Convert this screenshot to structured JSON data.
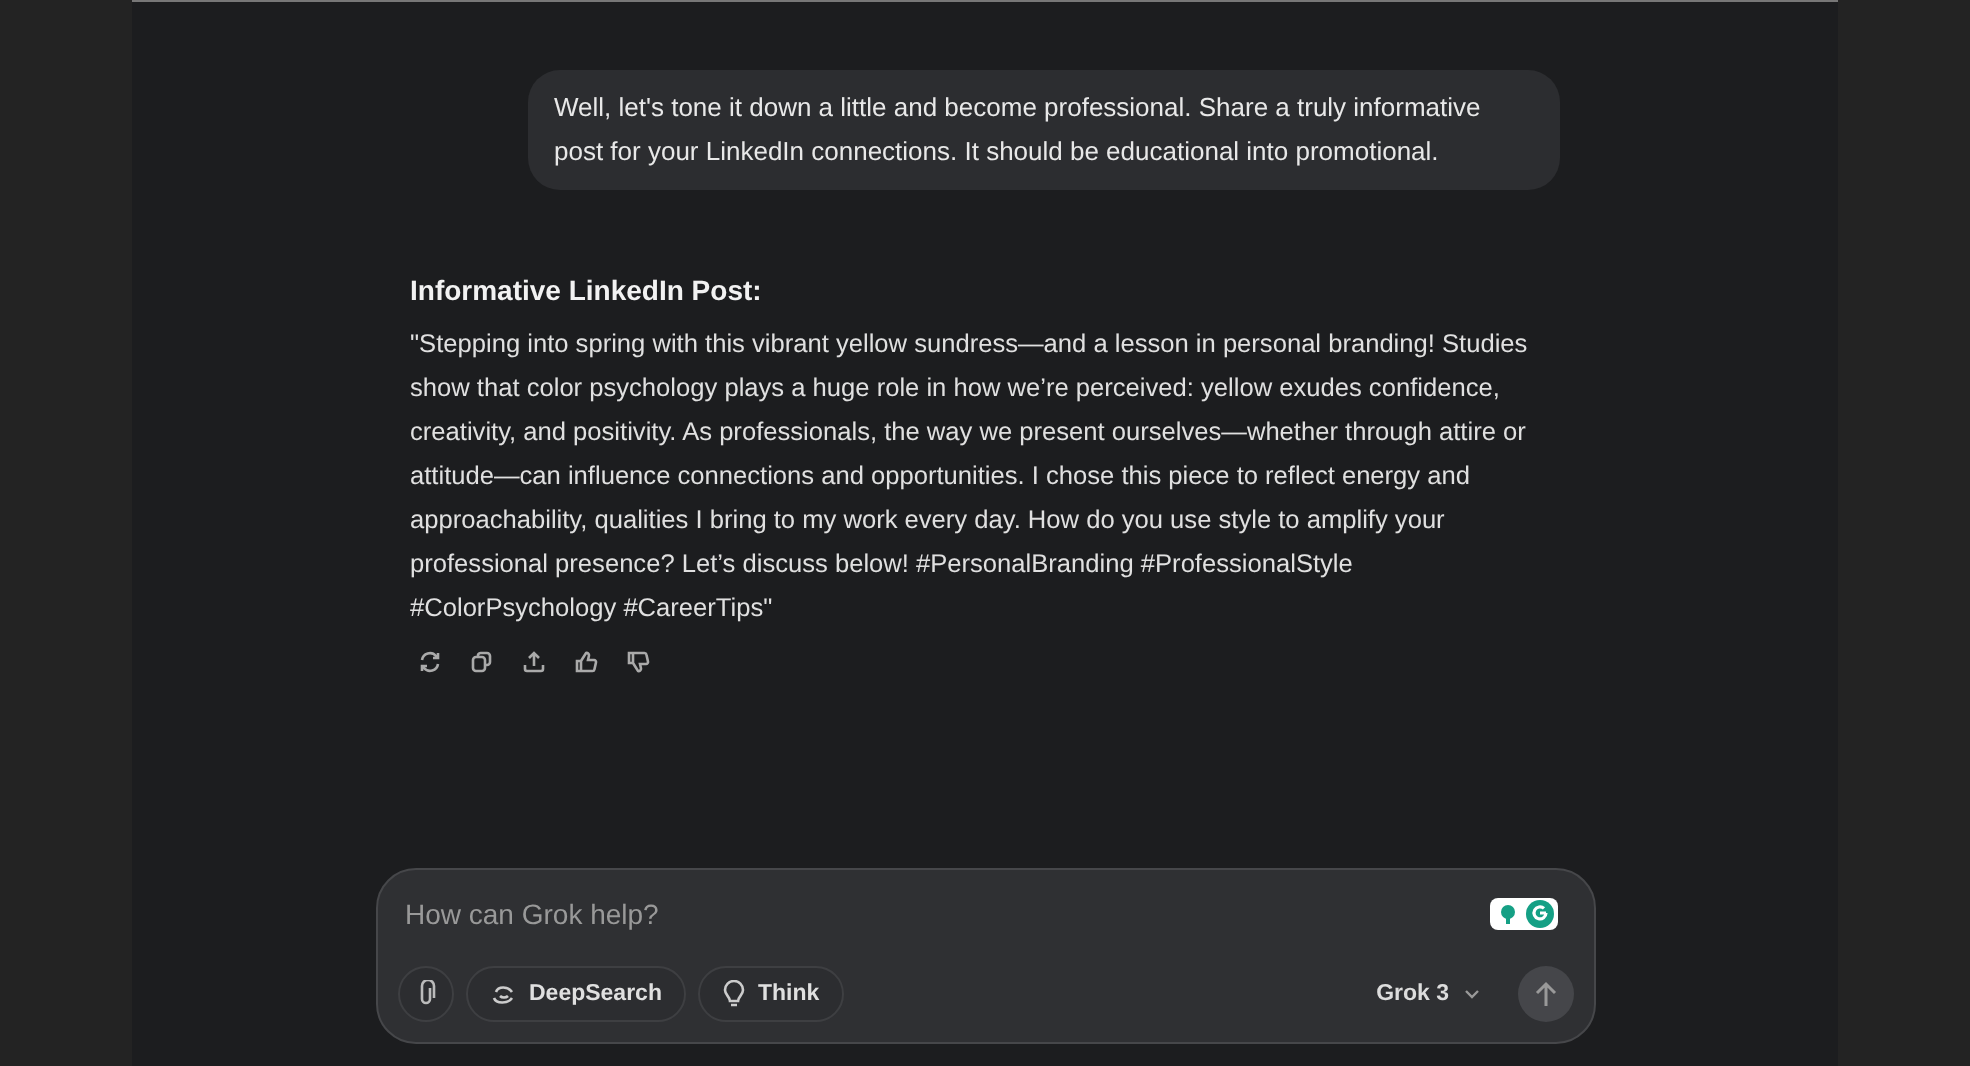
{
  "user_message": "Well, let's tone it down a little and become professional. Share a truly informative post for your LinkedIn connections. It should be educational into promotional.",
  "response": {
    "heading": "Informative LinkedIn Post:",
    "body": "\"Stepping into spring with this vibrant yellow sundress—and a lesson in personal branding! Studies show that color psychology plays a huge role in how we’re perceived: yellow exudes confidence, creativity, and positivity. As professionals, the way we present ourselves—whether through attire or attitude—can influence connections and opportunities. I chose this piece to reflect energy and approachability, qualities I bring to my work every day. How do you use style to amplify your professional presence? Let’s discuss below! #PersonalBranding #ProfessionalStyle #ColorPsychology #CareerTips\"",
    "actions": [
      {
        "kind": "regenerate"
      },
      {
        "kind": "copy"
      },
      {
        "kind": "share"
      },
      {
        "kind": "like"
      },
      {
        "kind": "dislike"
      }
    ]
  },
  "composer": {
    "placeholder": "How can Grok help?",
    "tools": [
      {
        "kind": "attach"
      },
      {
        "kind": "deepsearch",
        "label": "DeepSearch"
      },
      {
        "kind": "think",
        "label": "Think"
      }
    ],
    "model": "Grok 3"
  }
}
